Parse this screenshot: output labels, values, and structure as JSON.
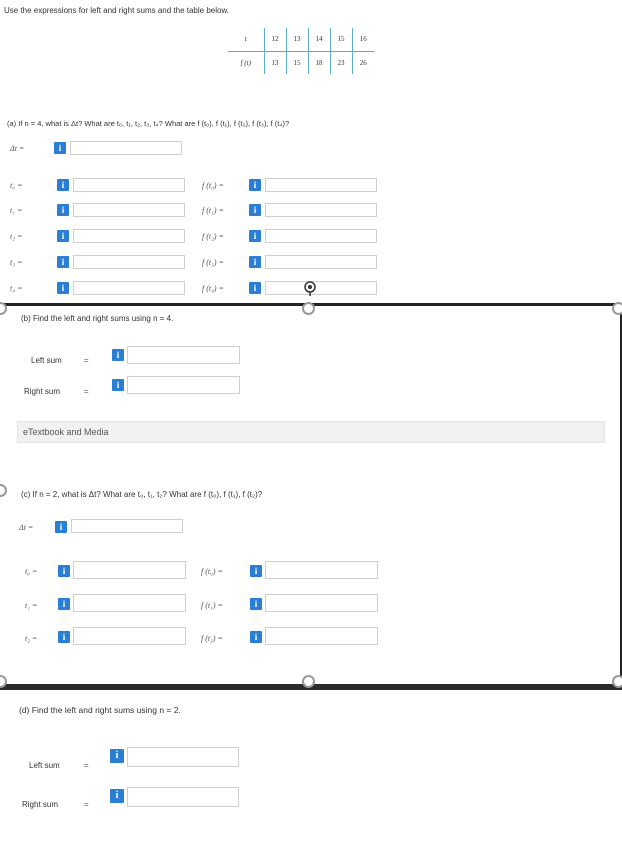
{
  "intro": "Use the expressions for left and right sums and the table below.",
  "table": {
    "t_label": "t",
    "f_label": "f (t)",
    "t_values": [
      "12",
      "13",
      "14",
      "15",
      "16"
    ],
    "f_values": [
      "13",
      "15",
      "18",
      "23",
      "26"
    ]
  },
  "part_a": {
    "question": "(a) If n = 4, what is Δt? What are t₀, t₁, t₂, t₃, t₄? What are f (t₀), f (t₁), f (t₂), f (t₃), f (t₄)?",
    "dt_label": "Δt =",
    "t_labels": [
      "t₀ =",
      "t₁ =",
      "t₂ =",
      "t₃ =",
      "t₄ ="
    ],
    "f_labels": [
      "f (t₀) =",
      "f (t₁) =",
      "f (t₂) =",
      "f (t₃) =",
      "f (t₄) ="
    ]
  },
  "part_b": {
    "question": "(b) Find the left and right sums using n = 4.",
    "left_label": "Left sum",
    "right_label": "Right sum",
    "eq": "="
  },
  "media_label": "eTextbook and Media",
  "part_c": {
    "question": "(c) If n = 2, what is Δt? What are t₀, t₁, t₂? What are f (t₀), f (t₁), f (t₂)?",
    "dt_label": "Δt =",
    "t_labels": [
      "t₀ =",
      "t₁ =",
      "t₂ ="
    ],
    "f_labels": [
      "f (t₀) =",
      "f (t₁) =",
      "f (t₂) ="
    ]
  },
  "part_d": {
    "question": "(d) Find the left and right sums using n = 2.",
    "left_label": "Left sum",
    "right_label": "Right sum",
    "eq": "="
  },
  "info_glyph": "i"
}
